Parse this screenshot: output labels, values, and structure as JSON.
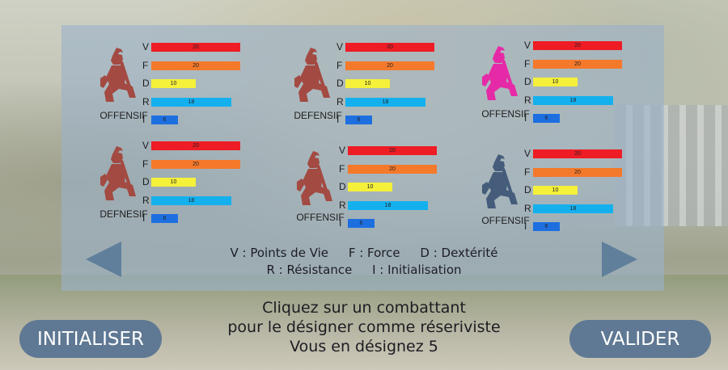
{
  "colors": {
    "V": "#ee1c24",
    "F": "#f4792b",
    "D": "#f5f03a",
    "R": "#14b0ee",
    "I": "#1d6fe0",
    "warrior_default": "#a34a42",
    "warrior_pink": "#e62aa7",
    "warrior_blue": "#455d7b"
  },
  "fighters": [
    {
      "role": "OFFENSIF",
      "color": "#a34a42",
      "stats": [
        {
          "k": "V",
          "v": "20",
          "n": 20
        },
        {
          "k": "F",
          "v": "20",
          "n": 20
        },
        {
          "k": "D",
          "v": "10",
          "n": 10
        },
        {
          "k": "R",
          "v": "18",
          "n": 18
        },
        {
          "k": "I",
          "v": "6",
          "n": 6
        }
      ]
    },
    {
      "role": "DEFENSIF",
      "color": "#a34a42",
      "stats": [
        {
          "k": "V",
          "v": "20",
          "n": 20
        },
        {
          "k": "F",
          "v": "20",
          "n": 20
        },
        {
          "k": "D",
          "v": "10",
          "n": 10
        },
        {
          "k": "R",
          "v": "18",
          "n": 18
        },
        {
          "k": "I",
          "v": "6",
          "n": 6
        }
      ]
    },
    {
      "role": "OFFENSIF",
      "color": "#e62aa7",
      "stats": [
        {
          "k": "V",
          "v": "20",
          "n": 20
        },
        {
          "k": "F",
          "v": "20",
          "n": 20
        },
        {
          "k": "D",
          "v": "10",
          "n": 10
        },
        {
          "k": "R",
          "v": "18",
          "n": 18
        },
        {
          "k": "I",
          "v": "6",
          "n": 6
        }
      ]
    },
    {
      "role": "DEFNESIF",
      "color": "#a34a42",
      "stats": [
        {
          "k": "V",
          "v": "20",
          "n": 20
        },
        {
          "k": "F",
          "v": "20",
          "n": 20
        },
        {
          "k": "D",
          "v": "10",
          "n": 10
        },
        {
          "k": "R",
          "v": "18",
          "n": 18
        },
        {
          "k": "I",
          "v": "6",
          "n": 6
        }
      ]
    },
    {
      "role": "OFFENSIF",
      "color": "#a34a42",
      "stats": [
        {
          "k": "V",
          "v": "20",
          "n": 20
        },
        {
          "k": "F",
          "v": "20",
          "n": 20
        },
        {
          "k": "D",
          "v": "10",
          "n": 10
        },
        {
          "k": "R",
          "v": "18",
          "n": 18
        },
        {
          "k": "I",
          "v": "6",
          "n": 6
        }
      ]
    },
    {
      "role": "OFFENSIF",
      "color": "#455d7b",
      "stats": [
        {
          "k": "V",
          "v": "20",
          "n": 20
        },
        {
          "k": "F",
          "v": "20",
          "n": 20
        },
        {
          "k": "D",
          "v": "10",
          "n": 10
        },
        {
          "k": "R",
          "v": "18",
          "n": 18
        },
        {
          "k": "I",
          "v": "6",
          "n": 6
        }
      ]
    }
  ],
  "legend": {
    "v": "V : Points de Vie",
    "f": "F : Force",
    "d": "D : Dextérité",
    "r": "R : Résistance",
    "i": "I : Initialisation"
  },
  "instructions": {
    "line1": "Cliquez sur un combattant",
    "line2": "pour le désigner comme réseriviste",
    "line3": "Vous en désignez 5"
  },
  "buttons": {
    "init": "INITIALISER",
    "valid": "VALIDER"
  },
  "icons": {
    "prev": "arrow-left-icon",
    "next": "arrow-right-icon",
    "fighter": "kneeling-spartan-warrior-icon"
  }
}
